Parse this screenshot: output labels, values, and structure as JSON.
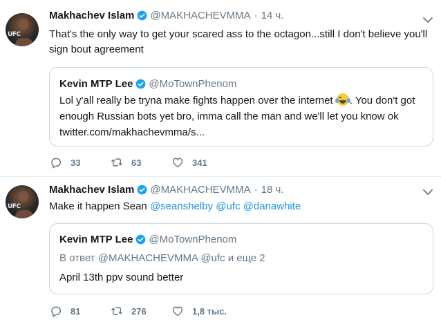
{
  "tweets": [
    {
      "author_name": "Makhachev Islam",
      "handle": "@MAKHACHEVMMA",
      "time": "14 ч.",
      "text": "That's the only way to get your scared ass to the octagon...still I don't believe you'll sign bout agreement",
      "avatar_text": "UFC",
      "quote": {
        "author_name": "Kevin MTP Lee",
        "handle": "@MoTownPhenom",
        "text_before_emoji": "Lol y'all really be tryna make fights happen over the internet ",
        "text_after_emoji": ". You don't got enough Russian bots yet bro, imma call the man and we'll let you know ok twitter.com/makhachevmma/s..."
      },
      "replies": "33",
      "retweets": "63",
      "likes": "341"
    },
    {
      "author_name": "Makhachev Islam",
      "handle": "@MAKHACHEVMMA",
      "time": "18 ч.",
      "text_prefix": "Make it happen Sean ",
      "mentions": [
        "@seanshelby",
        "@ufc",
        "@danawhite"
      ],
      "avatar_text": "UFC",
      "quote": {
        "author_name": "Kevin MTP Lee",
        "handle": "@MoTownPhenom",
        "reply_to": "В ответ @MAKHACHEVMMA @ufc и еще 2",
        "text": "April 13th ppv sound better"
      },
      "replies": "81",
      "retweets": "276",
      "likes": "1,8 тыс."
    }
  ],
  "separator": "·",
  "colors": {
    "accent": "#1b95e0",
    "muted": "#657786",
    "border": "#ccd6dd",
    "text": "#14171a"
  },
  "icons": {
    "verified": "verified-badge-icon",
    "caret": "chevron-down-icon",
    "reply": "reply-icon",
    "retweet": "retweet-icon",
    "like": "heart-icon",
    "emoji": "face-with-tears-of-joy-emoji"
  }
}
